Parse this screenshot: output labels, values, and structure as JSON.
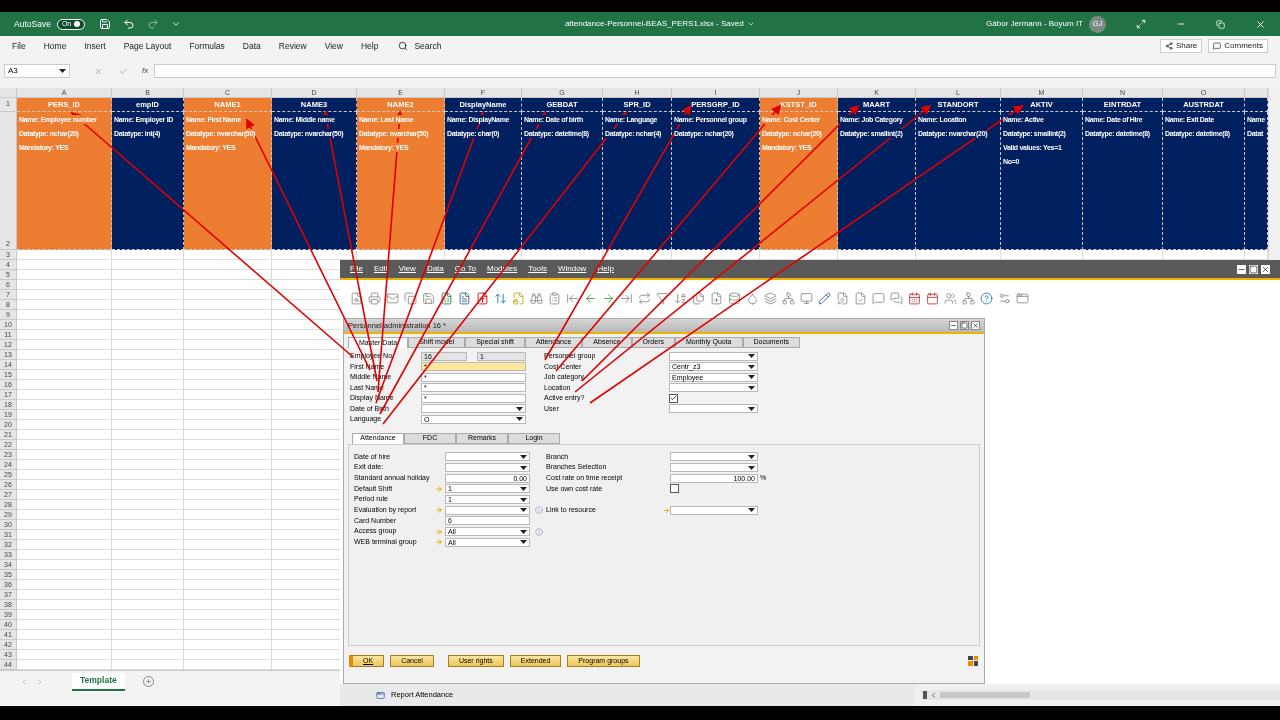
{
  "excel": {
    "autosave": {
      "label": "AutoSave",
      "state": "On",
      "on": true
    },
    "title": "attendance-Personnel-BEAS_PERS1.xlsx - Saved",
    "user": "Gábor Jermann - Boyum IT",
    "avatar": "GJ",
    "menu": [
      "File",
      "Home",
      "Insert",
      "Page Layout",
      "Formulas",
      "Data",
      "Review",
      "View",
      "Help"
    ],
    "search": "Search",
    "share": "Share",
    "comments": "Comments",
    "name_box": "A3",
    "fx": "fx",
    "columns": [
      {
        "letter": "A",
        "field": "PERS_ID",
        "lines": [
          "Name: Employee number",
          "Datatype: nchar(20)",
          "Mandatory: YES"
        ],
        "color": "#ed7d31"
      },
      {
        "letter": "B",
        "field": "empID",
        "lines": [
          "Name: Employer ID",
          "Datatype: int(4)"
        ],
        "color": "#002060"
      },
      {
        "letter": "C",
        "field": "NAME1",
        "lines": [
          "Name: First Name",
          "Datatype: nvarchar(50)",
          "Mandatory: YES"
        ],
        "color": "#ed7d31"
      },
      {
        "letter": "D",
        "field": "NAME3",
        "lines": [
          "Name: Middle name",
          "Datatype: nvarchar(50)"
        ],
        "color": "#002060"
      },
      {
        "letter": "E",
        "field": "NAME2",
        "lines": [
          "Name: Last Name",
          "Datatype: nvarchar(50)",
          "Mandatory: YES"
        ],
        "color": "#ed7d31"
      },
      {
        "letter": "F",
        "field": "DisplayName",
        "lines": [
          "Name: DisplayName",
          "Datatype: char(0)"
        ],
        "color": "#002060"
      },
      {
        "letter": "G",
        "field": "GEBDAT",
        "lines": [
          "Name: Date of birth",
          "Datatype: datetime(8)"
        ],
        "color": "#002060"
      },
      {
        "letter": "H",
        "field": "SPR_ID",
        "lines": [
          "Name: Language",
          "Datatype: nchar(4)"
        ],
        "color": "#002060"
      },
      {
        "letter": "I",
        "field": "PERSGRP_ID",
        "lines": [
          "Name: Personnel group",
          "Datatype: nchar(20)"
        ],
        "color": "#002060"
      },
      {
        "letter": "J",
        "field": "KSTST_ID",
        "lines": [
          "Name: Cost Center",
          "Datatype: nchar(20)",
          "Mandatory: YES"
        ],
        "color": "#ed7d31"
      },
      {
        "letter": "K",
        "field": "MAART",
        "lines": [
          "Name: Job Category",
          "Datatype: smallint(2)"
        ],
        "color": "#002060"
      },
      {
        "letter": "L",
        "field": "STANDORT",
        "lines": [
          "Name: Location",
          "Datatype: nvarchar(20)"
        ],
        "color": "#002060"
      },
      {
        "letter": "M",
        "field": "AKTIV",
        "lines": [
          "Name: Active",
          "Datatype: smallint(2)",
          "Valid values: Yes=1",
          "No=0"
        ],
        "color": "#002060"
      },
      {
        "letter": "N",
        "field": "EINTRDAT",
        "lines": [
          "Name: Date of Hire",
          "Datatype: datetime(8)"
        ],
        "color": "#002060"
      },
      {
        "letter": "O",
        "field": "AUSTRDAT",
        "lines": [
          "Name: Exit Date",
          "Datatype: datetime(8)"
        ],
        "color": "#002060"
      },
      {
        "lines": [
          "Name",
          "Datat"
        ],
        "color": "#002060"
      }
    ],
    "row_numbers": [
      "1",
      "2",
      "3",
      "4",
      "5",
      "6",
      "7",
      "8",
      "9",
      "10",
      "11",
      "12",
      "13",
      "14",
      "15",
      "16",
      "17",
      "18",
      "19",
      "20",
      "21",
      "22",
      "23",
      "24",
      "25",
      "26",
      "27",
      "28",
      "29",
      "30",
      "31",
      "32",
      "33",
      "34",
      "35",
      "36",
      "37",
      "38",
      "39",
      "40",
      "41",
      "42",
      "43",
      "44"
    ],
    "sheet_tabs": [
      {
        "label": "Template",
        "selected": true
      }
    ]
  },
  "sap": {
    "menu": [
      "File",
      "Edit",
      "View",
      "Data",
      "Go To",
      "Modules",
      "Tools",
      "Window",
      "Help"
    ],
    "dialog": {
      "title": "Personnel administration 16 *",
      "tabs": [
        {
          "label": "Master Data",
          "selected": true
        },
        {
          "label": "Shift model",
          "selected": false
        },
        {
          "label": "Special shift",
          "selected": false
        },
        {
          "label": "Attendance",
          "selected": false
        },
        {
          "label": "Absence",
          "selected": false
        },
        {
          "label": "Orders",
          "selected": false
        },
        {
          "label": "Monthly Quota",
          "selected": false
        },
        {
          "label": "Documents",
          "selected": false
        }
      ],
      "left_fields": [
        {
          "label": "Employee No.",
          "kind": "readonly_pair",
          "values": [
            "16",
            "1"
          ]
        },
        {
          "label": "First Name",
          "kind": "mandatory",
          "value": "*"
        },
        {
          "label": "Middle Name",
          "kind": "text",
          "value": "*"
        },
        {
          "label": "Last Name",
          "kind": "text",
          "value": "*"
        },
        {
          "label": "Display Name",
          "kind": "text",
          "value": "*"
        },
        {
          "label": "Date of Birth",
          "kind": "dropdown"
        },
        {
          "label": "Language",
          "kind": "dropdown",
          "value": "O"
        }
      ],
      "right_fields": [
        {
          "label": "Personnel group",
          "kind": "dropdown"
        },
        {
          "label": "Cost Center",
          "kind": "dropdown",
          "value": "Centr_z3"
        },
        {
          "label": "Job category",
          "kind": "dropdown",
          "value": "Employee"
        },
        {
          "label": "Location",
          "kind": "dropdown"
        },
        {
          "label": "Active entry?",
          "kind": "checkbox",
          "checked": true
        },
        {
          "label": "User",
          "kind": "dropdown"
        }
      ],
      "subtabs": [
        {
          "label": "Attendance",
          "selected": true
        },
        {
          "label": "FDC",
          "selected": false
        },
        {
          "label": "Remarks",
          "selected": false
        },
        {
          "label": "Login",
          "selected": false
        }
      ],
      "sub_left": [
        {
          "label": "Date of hire",
          "kind": "dropdown",
          "link": false,
          "info": false
        },
        {
          "label": "Exit date:",
          "kind": "dropdown",
          "link": false,
          "info": false
        },
        {
          "label": "Standard annual holiday",
          "kind": "number",
          "value": "0.00",
          "link": false,
          "info": false
        },
        {
          "label": "Default Shift",
          "kind": "dropdown",
          "value": "1",
          "link": true,
          "info": false
        },
        {
          "label": "Period rule",
          "kind": "dropdown",
          "value": "1",
          "link": false,
          "info": false
        },
        {
          "label": "Evaluation by report",
          "kind": "dropdown",
          "link": true,
          "info": true
        },
        {
          "label": "Card Number",
          "kind": "text",
          "value": "6",
          "link": false,
          "info": false
        },
        {
          "label": "Access group",
          "kind": "dropdown",
          "value": "All",
          "link": true,
          "info": true
        },
        {
          "label": "WEB terminal group",
          "kind": "dropdown",
          "value": "All",
          "link": true,
          "info": false
        }
      ],
      "sub_right": [
        {
          "label": "Branch",
          "kind": "dropdown",
          "link": false
        },
        {
          "label": "Branches Selection",
          "kind": "dropdown",
          "link": false
        },
        {
          "label": "Cost rate on time receipt",
          "kind": "number",
          "value": "100.00",
          "unit": "%",
          "link": false
        },
        {
          "label": "Use own cost rate",
          "kind": "checkbox",
          "checked": false,
          "link": false
        },
        {
          "label": "Link to resource",
          "kind": "dropdown",
          "link": true
        }
      ],
      "buttons": [
        {
          "label": "OK",
          "default": true
        },
        {
          "label": "Cancel",
          "default": false
        },
        {
          "label": "User rights",
          "default": false
        },
        {
          "label": "Extended",
          "default": false
        },
        {
          "label": "Program groups",
          "default": false
        }
      ]
    },
    "report_item": "Report Attendance"
  }
}
